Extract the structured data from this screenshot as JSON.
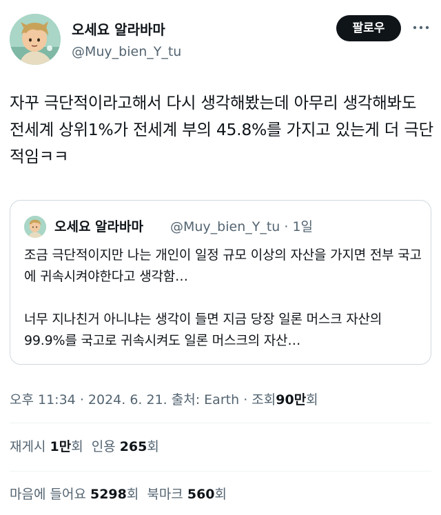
{
  "author": {
    "display_name": "오세요 알라바마",
    "handle": "@Muy_bien_Y_tu",
    "follow_label": "팔로우"
  },
  "tweet": {
    "text": "자꾸 극단적이라고해서 다시 생각해봤는데 아무리 생각해봐도 전세계 상위1%가 전세계 부의 45.8%를 가지고 있는게 더 극단적임ㅋㅋ"
  },
  "quote": {
    "display_name": "오세요 알라바마",
    "meta": "@Muy_bien_Y_tu · 1일",
    "para1": "조금 극단적이지만 나는 개인이 일정 규모 이상의 자산을 가지면 전부 국고에 귀속시켜야한다고 생각함…",
    "para2": "너무 지나친거 아니냐는 생각이 들면 지금 당장 일론 머스크 자산의 99.9%를 국고로 귀속시켜도 일론 머스크의 자산…"
  },
  "meta": {
    "time": "오후 11:34",
    "date": "2024. 6. 21.",
    "source": "출처: Earth",
    "views_label": "조회",
    "views_value": "90만",
    "views_suffix": "회",
    "sep": "·"
  },
  "stats": {
    "reposts_label": "재게시",
    "reposts_value": "1만",
    "reposts_suffix": "회",
    "quotes_label": "인용",
    "quotes_value": "265",
    "quotes_suffix": "회",
    "likes_label": "마음에 들어요",
    "likes_value": "5298",
    "likes_suffix": "회",
    "bookmarks_label": "북마크",
    "bookmarks_value": "560",
    "bookmarks_suffix": "회"
  },
  "colors": {
    "text_primary": "#0f1419",
    "text_secondary": "#536471",
    "border": "#cfd9de",
    "follow_bg": "#0f1419"
  },
  "icons": {
    "more": "more-horizontal-icon"
  }
}
